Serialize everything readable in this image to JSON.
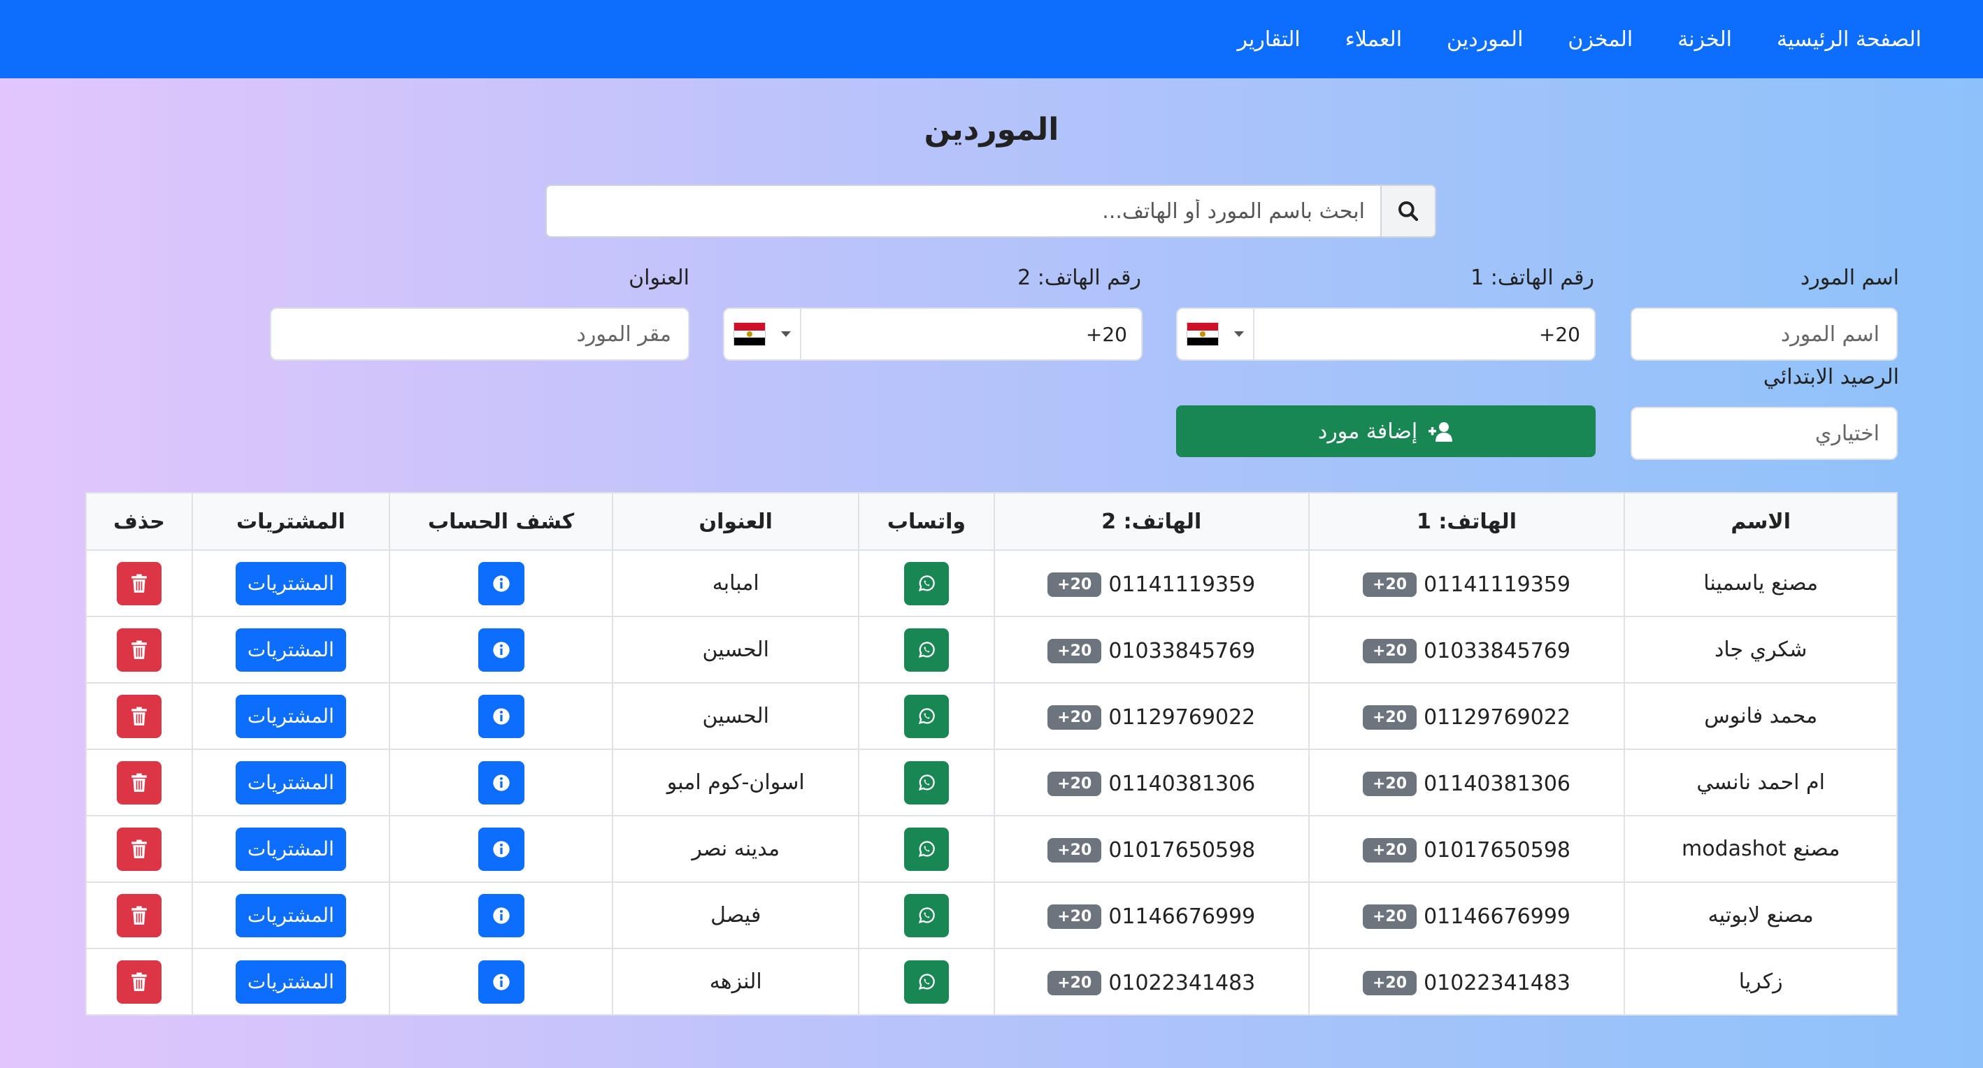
{
  "nav": {
    "items": [
      "الصفحة الرئيسية",
      "الخزنة",
      "المخزن",
      "الموردين",
      "العملاء",
      "التقارير"
    ]
  },
  "page": {
    "title": "الموردين"
  },
  "search": {
    "placeholder": "ابحث باسم المورد أو الهاتف..."
  },
  "form": {
    "name_label": "اسم المورد",
    "name_placeholder": "اسم المورد",
    "phone1_label": "رقم الهاتف: 1",
    "phone1_value": "+20",
    "phone2_label": "رقم الهاتف: 2",
    "phone2_value": "+20",
    "address_label": "العنوان",
    "address_placeholder": "مقر المورد",
    "balance_label": "الرصيد الابتدائي",
    "balance_placeholder": "اختياري",
    "add_button": "إضافة مورد",
    "country_flag": "egypt-flag-icon"
  },
  "table": {
    "headers": [
      "الاسم",
      "الهاتف: 1",
      "الهاتف: 2",
      "واتساب",
      "العنوان",
      "كشف الحساب",
      "المشتريات",
      "حذف"
    ],
    "country_code": "+20",
    "purchases_label": "المشتريات",
    "rows": [
      {
        "name": "مصنع ياسمينا",
        "phone1": "01141119359",
        "phone2": "01141119359",
        "address": "امبابه"
      },
      {
        "name": "شكري جاد",
        "phone1": "01033845769",
        "phone2": "01033845769",
        "address": "الحسين"
      },
      {
        "name": "محمد فانوس",
        "phone1": "01129769022",
        "phone2": "01129769022",
        "address": "الحسين"
      },
      {
        "name": "ام احمد نانسي",
        "phone1": "01140381306",
        "phone2": "01140381306",
        "address": "اسوان-كوم امبو"
      },
      {
        "name": "مصنع modashot",
        "phone1": "01017650598",
        "phone2": "01017650598",
        "address": "مدينه نصر"
      },
      {
        "name": "مصنع لابوتيه",
        "phone1": "01146676999",
        "phone2": "01146676999",
        "address": "فيصل"
      },
      {
        "name": "زكريا",
        "phone1": "01022341483",
        "phone2": "01022341483",
        "address": "النزهه"
      }
    ]
  },
  "colors": {
    "primary": "#0d6efd",
    "success": "#198754",
    "danger": "#dc3545",
    "badge": "#6c757d"
  }
}
